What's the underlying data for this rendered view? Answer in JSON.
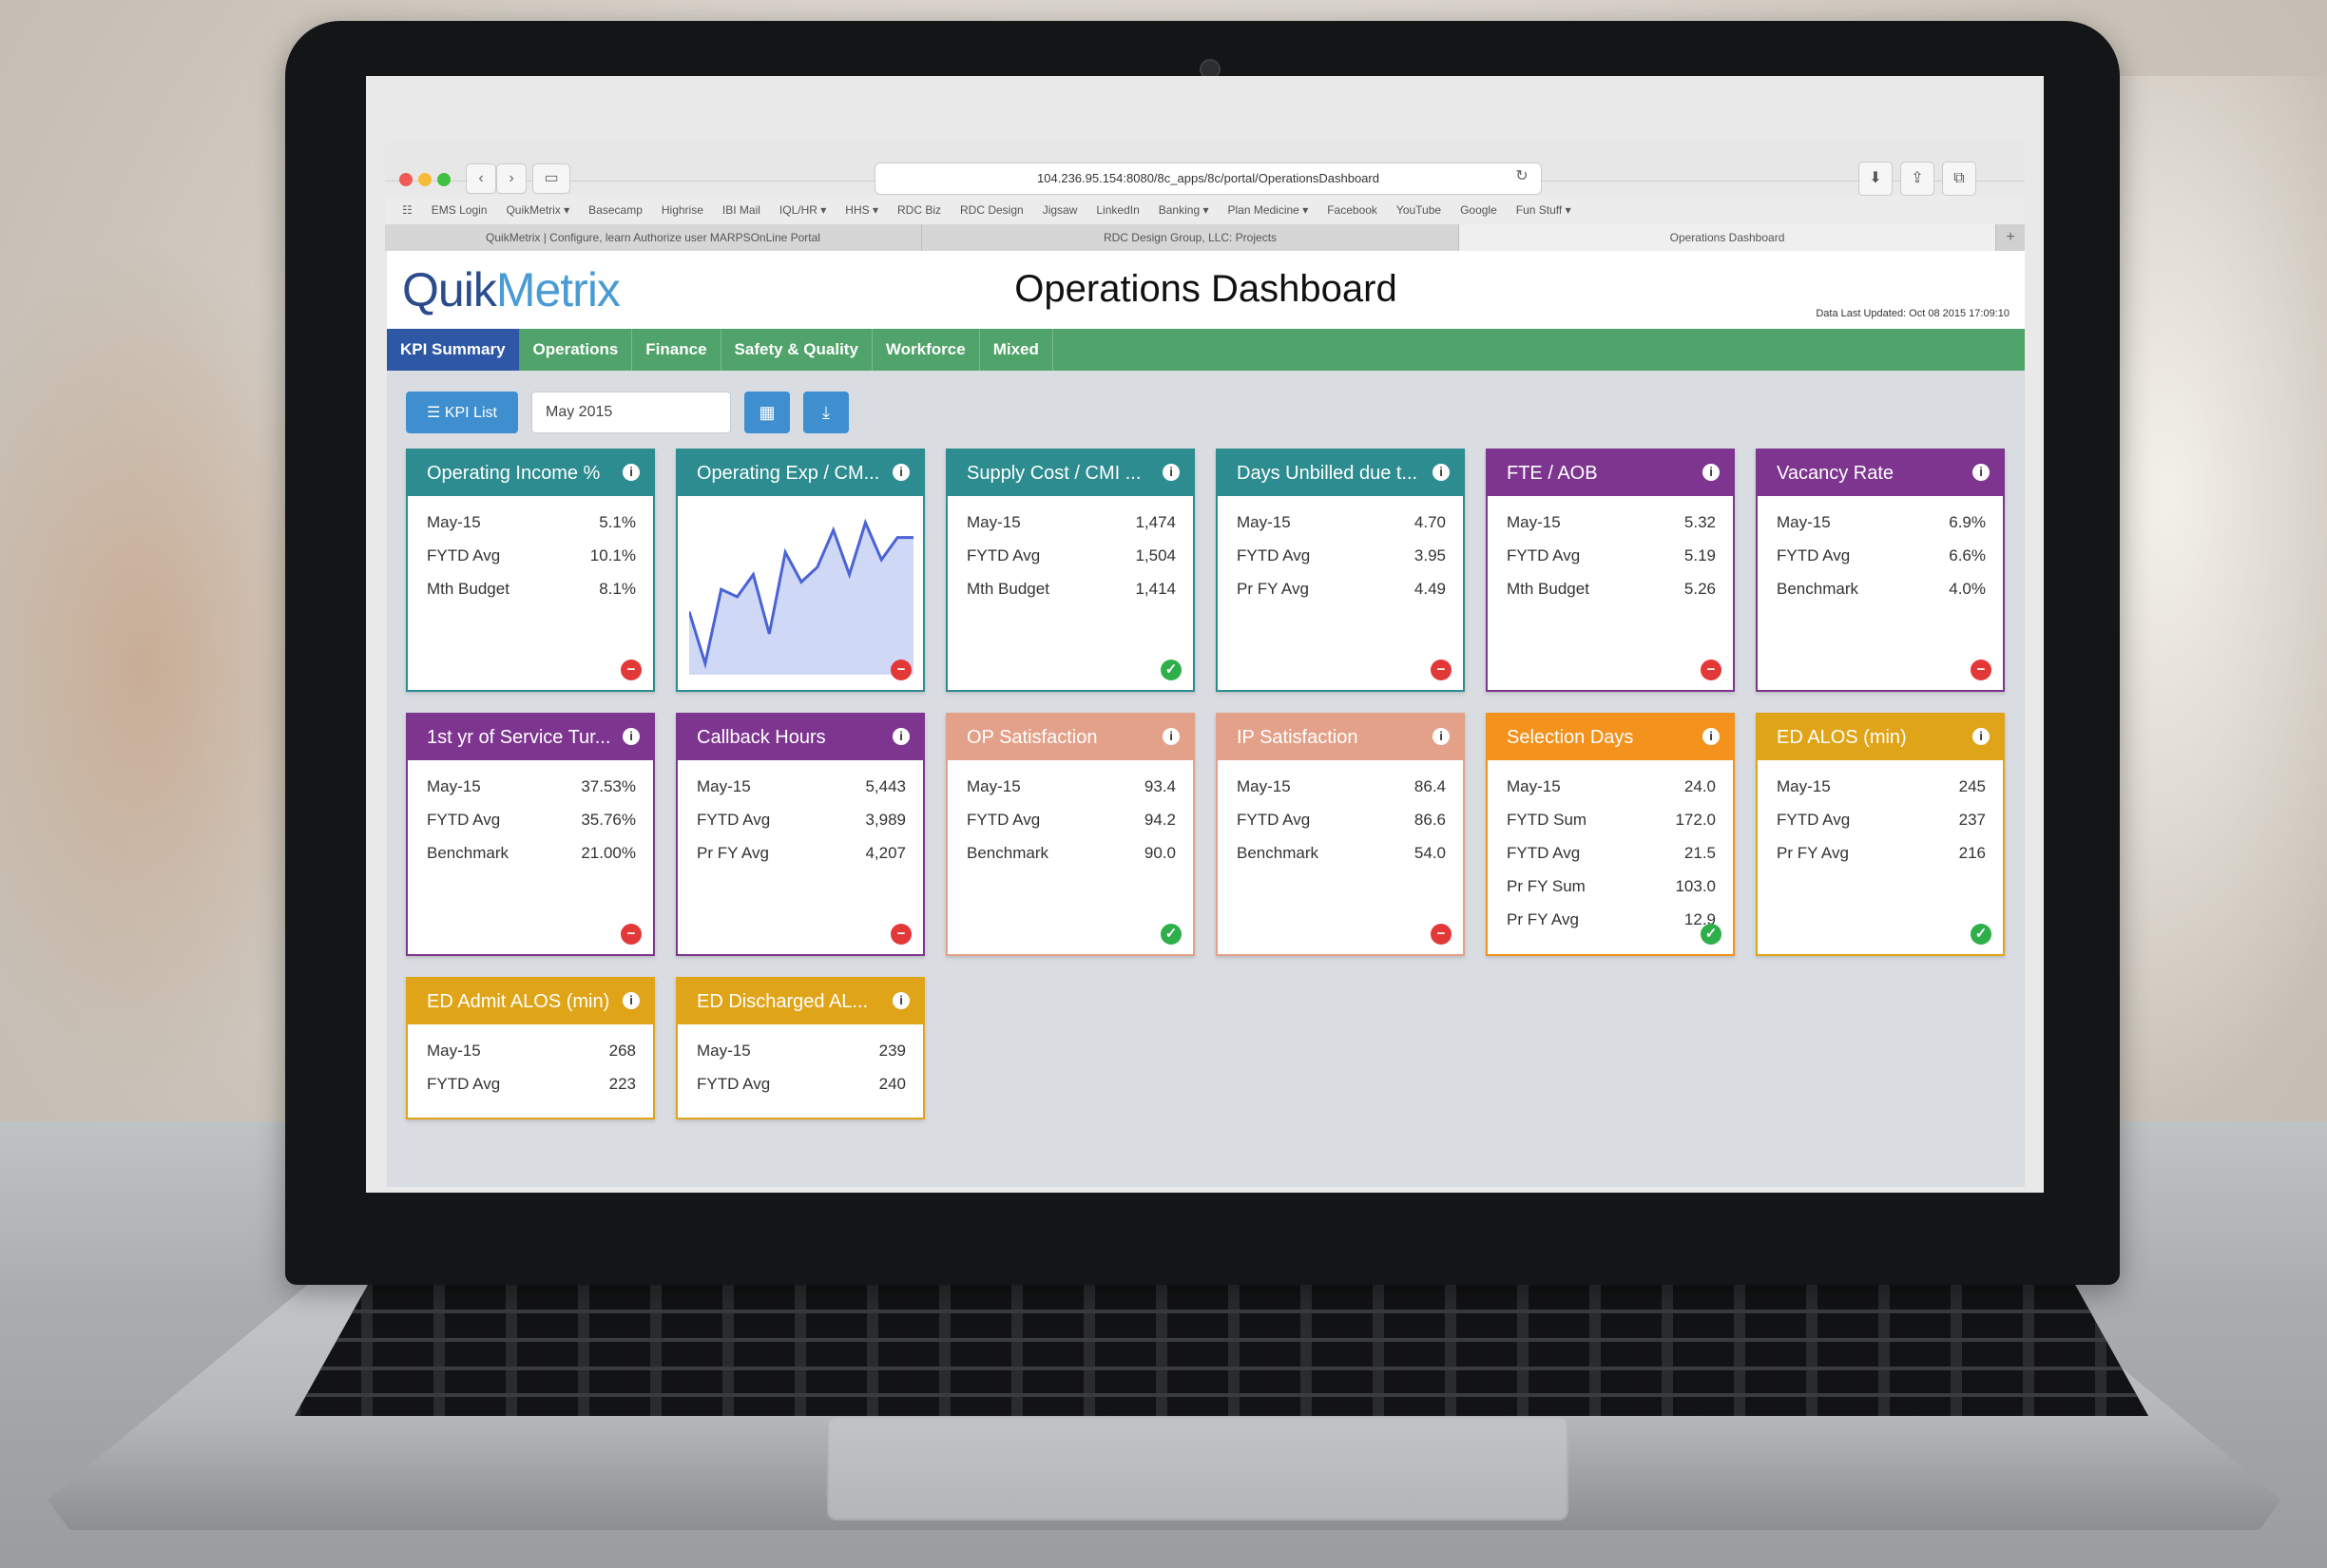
{
  "browser": {
    "url": "104.236.95.154:8080/8c_apps/8c/portal/OperationsDashboard",
    "bookmarks": [
      "EMS Login",
      "QuikMetrix ▾",
      "Basecamp",
      "Highrise",
      "IBI Mail",
      "IQL/HR ▾",
      "HHS ▾",
      "RDC Biz",
      "RDC Design",
      "Jigsaw",
      "LinkedIn",
      "Banking ▾",
      "Plan Medicine ▾",
      "Facebook",
      "YouTube",
      "Google",
      "Fun Stuff ▾"
    ],
    "tabs": [
      {
        "label": "QuikMetrix | Configure, learn Authorize user MARPSOnLine Portal",
        "active": false
      },
      {
        "label": "RDC Design Group, LLC: Projects",
        "active": false
      },
      {
        "label": "Operations Dashboard",
        "active": true
      }
    ],
    "icons": {
      "back": "back-icon",
      "forward": "forward-icon",
      "sidebar": "sidebar-icon",
      "reload": "reload-icon",
      "download": "download-icon",
      "share": "share-icon",
      "tabs": "tabs-icon"
    }
  },
  "app": {
    "logo": {
      "part1": "Quik",
      "part2": "Metrix"
    },
    "title": "Operations Dashboard",
    "last_updated": "Data Last Updated: Oct 08 2015 17:09:10",
    "nav_tabs": [
      {
        "label": "KPI Summary",
        "active": true
      },
      {
        "label": "Operations",
        "active": false
      },
      {
        "label": "Finance",
        "active": false
      },
      {
        "label": "Safety & Quality",
        "active": false
      },
      {
        "label": "Workforce",
        "active": false
      },
      {
        "label": "Mixed",
        "active": false
      }
    ],
    "toolbar": {
      "kpi_list_label": "☰ KPI List",
      "date_value": "May 2015",
      "calendar_icon": "calendar-icon",
      "download_icon": "download-icon"
    },
    "colors": {
      "teal": "#2c8c8f",
      "purple": "#7d3590",
      "salmon": "#e3a189",
      "orange": "#f3921c",
      "gold": "#e0a418",
      "nav_green": "#50a36a",
      "nav_active": "#2e57a5",
      "status_bad": "#e33838",
      "status_good": "#2faf4a"
    }
  },
  "cards": [
    {
      "title": "Operating Income %",
      "color": "teal",
      "rows": [
        {
          "label": "May-15",
          "value": "5.1%"
        },
        {
          "label": "FYTD Avg",
          "value": "10.1%"
        },
        {
          "label": "Mth Budget",
          "value": "8.1%"
        }
      ],
      "status": "bad"
    },
    {
      "title": "Operating Exp / CM...",
      "color": "teal",
      "rows": [],
      "sparkline": [
        40,
        5,
        55,
        50,
        65,
        25,
        80,
        60,
        70,
        95,
        65,
        100,
        75,
        90,
        90
      ],
      "status": "bad"
    },
    {
      "title": "Supply Cost / CMI ...",
      "color": "teal",
      "rows": [
        {
          "label": "May-15",
          "value": "1,474"
        },
        {
          "label": "FYTD Avg",
          "value": "1,504"
        },
        {
          "label": "Mth Budget",
          "value": "1,414"
        }
      ],
      "status": "good"
    },
    {
      "title": "Days Unbilled due t...",
      "color": "teal",
      "rows": [
        {
          "label": "May-15",
          "value": "4.70"
        },
        {
          "label": "FYTD Avg",
          "value": "3.95"
        },
        {
          "label": "Pr FY Avg",
          "value": "4.49"
        }
      ],
      "status": "bad"
    },
    {
      "title": "FTE / AOB",
      "color": "purple",
      "rows": [
        {
          "label": "May-15",
          "value": "5.32"
        },
        {
          "label": "FYTD Avg",
          "value": "5.19"
        },
        {
          "label": "Mth Budget",
          "value": "5.26"
        }
      ],
      "status": "bad"
    },
    {
      "title": "Vacancy Rate",
      "color": "purple",
      "rows": [
        {
          "label": "May-15",
          "value": "6.9%"
        },
        {
          "label": "FYTD Avg",
          "value": "6.6%"
        },
        {
          "label": "Benchmark",
          "value": "4.0%"
        }
      ],
      "status": "bad"
    },
    {
      "title": "1st yr of Service Tur...",
      "color": "purple",
      "rows": [
        {
          "label": "May-15",
          "value": "37.53%"
        },
        {
          "label": "FYTD Avg",
          "value": "35.76%"
        },
        {
          "label": "Benchmark",
          "value": "21.00%"
        }
      ],
      "status": "bad"
    },
    {
      "title": "Callback Hours",
      "color": "purple",
      "rows": [
        {
          "label": "May-15",
          "value": "5,443"
        },
        {
          "label": "FYTD Avg",
          "value": "3,989"
        },
        {
          "label": "Pr FY Avg",
          "value": "4,207"
        }
      ],
      "status": "bad"
    },
    {
      "title": "OP Satisfaction",
      "color": "salmon",
      "rows": [
        {
          "label": "May-15",
          "value": "93.4"
        },
        {
          "label": "FYTD Avg",
          "value": "94.2"
        },
        {
          "label": "Benchmark",
          "value": "90.0"
        }
      ],
      "status": "good"
    },
    {
      "title": "IP Satisfaction",
      "color": "salmon",
      "rows": [
        {
          "label": "May-15",
          "value": "86.4"
        },
        {
          "label": "FYTD Avg",
          "value": "86.6"
        },
        {
          "label": "Benchmark",
          "value": "54.0"
        }
      ],
      "status": "bad"
    },
    {
      "title": "Selection Days",
      "color": "orange",
      "rows": [
        {
          "label": "May-15",
          "value": "24.0"
        },
        {
          "label": "FYTD Sum",
          "value": "172.0"
        },
        {
          "label": "FYTD Avg",
          "value": "21.5"
        },
        {
          "label": "Pr FY Sum",
          "value": "103.0"
        },
        {
          "label": "Pr FY Avg",
          "value": "12.9"
        }
      ],
      "status": "good"
    },
    {
      "title": "ED ALOS (min)",
      "color": "gold",
      "rows": [
        {
          "label": "May-15",
          "value": "245"
        },
        {
          "label": "FYTD Avg",
          "value": "237"
        },
        {
          "label": "Pr FY Avg",
          "value": "216"
        }
      ],
      "status": "good"
    },
    {
      "title": "ED Admit ALOS (min)",
      "color": "gold",
      "rows": [
        {
          "label": "May-15",
          "value": "268"
        },
        {
          "label": "FYTD Avg",
          "value": "223"
        }
      ],
      "status": ""
    },
    {
      "title": "ED Discharged AL...",
      "color": "gold",
      "rows": [
        {
          "label": "May-15",
          "value": "239"
        },
        {
          "label": "FYTD Avg",
          "value": "240"
        }
      ],
      "status": ""
    }
  ]
}
